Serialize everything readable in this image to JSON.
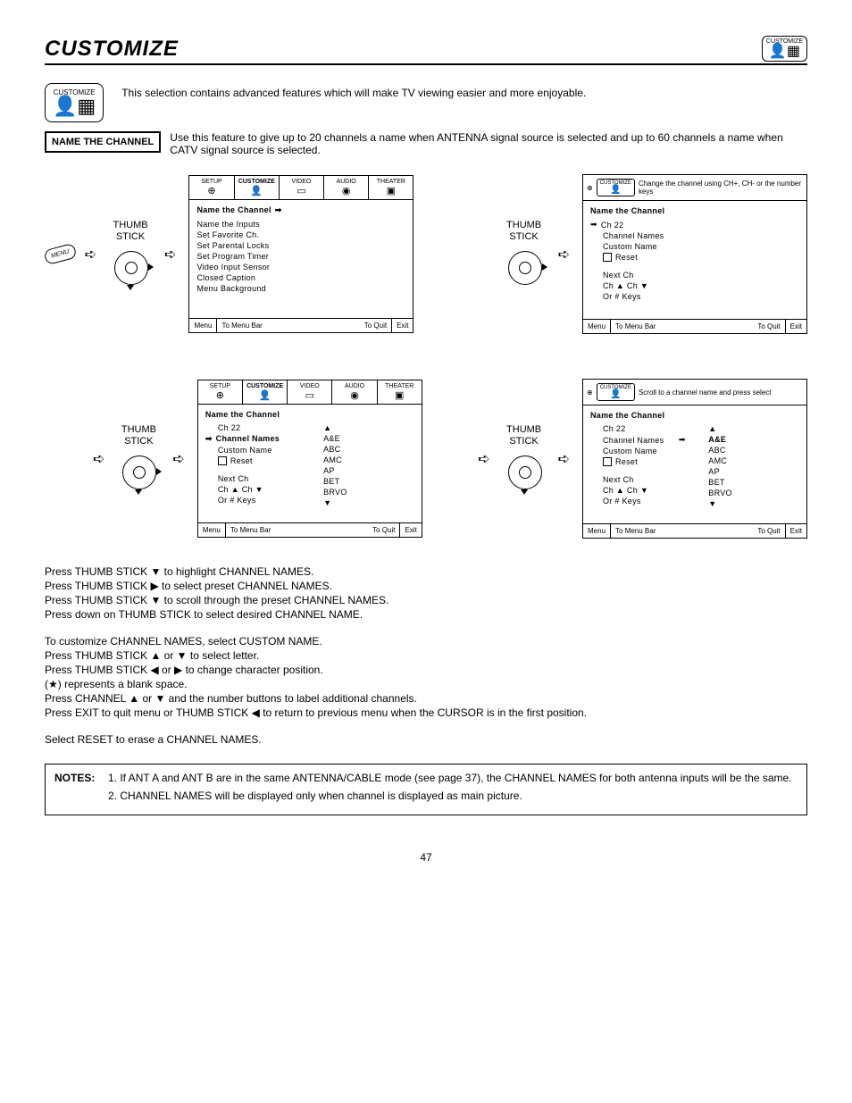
{
  "page": {
    "title": "CUSTOMIZE",
    "number": "47",
    "badge_label": "CUSTOMIZE"
  },
  "intro": "This selection contains advanced features which will make TV viewing easier and more enjoyable.",
  "feature": {
    "label": "NAME THE CHANNEL",
    "desc": "Use this feature to give up to 20 channels a name when ANTENNA signal source is selected and up to 60 channels a name when CATV signal source is selected."
  },
  "thumb_label_1": "THUMB",
  "thumb_label_2": "STICK",
  "menu_btn": "MENU",
  "tabs": {
    "setup": "SETUP",
    "customize": "CUSTOMIZE",
    "video": "VIDEO",
    "audio": "AUDIO",
    "theater": "THEATER"
  },
  "footer": {
    "menu": "Menu",
    "to_menu_bar": "To Menu Bar",
    "to_quit": "To Quit",
    "exit": "Exit"
  },
  "panel1": {
    "heading": "Name the Channel",
    "items": [
      "Name the Inputs",
      "Set Favorite Ch.",
      "Set Parental Locks",
      "Set Program Timer",
      "Video Input Sensor",
      "Closed Caption",
      "Menu Background"
    ]
  },
  "panel2": {
    "hint": "Change the channel using CH+, CH- or the number keys",
    "heading": "Name the Channel",
    "ch": "Ch 22",
    "items": [
      "Channel Names",
      "Custom Name"
    ],
    "reset": "Reset",
    "next": "Next Ch",
    "chline": "Ch ▲ Ch ▼",
    "or": "Or # Keys"
  },
  "panel3": {
    "heading": "Name the Channel",
    "ch": "Ch 22",
    "cn": "Channel Names",
    "custom": "Custom Name",
    "reset": "Reset",
    "next": "Next Ch",
    "chline": "Ch ▲ Ch ▼",
    "or": "Or # Keys",
    "names": [
      "A&E",
      "ABC",
      "AMC",
      "AP",
      "BET",
      "BRVO"
    ]
  },
  "panel4": {
    "hint": "Scroll to a channel name and press select",
    "heading": "Name the Channel",
    "ch": "Ch 22",
    "cn": "Channel Names",
    "custom": "Custom Name",
    "reset": "Reset",
    "next": "Next Ch",
    "chline": "Ch ▲ Ch ▼",
    "or": "Or # Keys",
    "names": [
      "A&E",
      "ABC",
      "AMC",
      "AP",
      "BET",
      "BRVO"
    ]
  },
  "instructions": {
    "l1": "Press THUMB STICK ▼ to highlight CHANNEL NAMES.",
    "l2": "Press THUMB STICK ▶ to select preset CHANNEL NAMES.",
    "l3": "Press THUMB STICK ▼ to scroll through the preset CHANNEL NAMES.",
    "l4": "Press down on THUMB STICK to select desired CHANNEL NAME.",
    "l5": "To customize CHANNEL NAMES, select CUSTOM NAME.",
    "l6": "Press THUMB STICK ▲ or ▼ to select letter.",
    "l7": "Press THUMB STICK ◀ or ▶ to change character position.",
    "l8": "(★) represents a blank space.",
    "l9": "Press CHANNEL ▲ or ▼  and the number buttons to label additional channels.",
    "l10": "Press EXIT to quit menu or THUMB STICK ◀ to return to previous menu when the CURSOR is in the first position.",
    "l11": "Select RESET to erase a CHANNEL NAMES."
  },
  "notes": {
    "label": "NOTES:",
    "n1": "If ANT A and ANT B are in the same ANTENNA/CABLE mode (see page 37), the CHANNEL NAMES for both antenna inputs will be the same.",
    "n2": "CHANNEL NAMES will be displayed only when channel is displayed as main picture."
  }
}
